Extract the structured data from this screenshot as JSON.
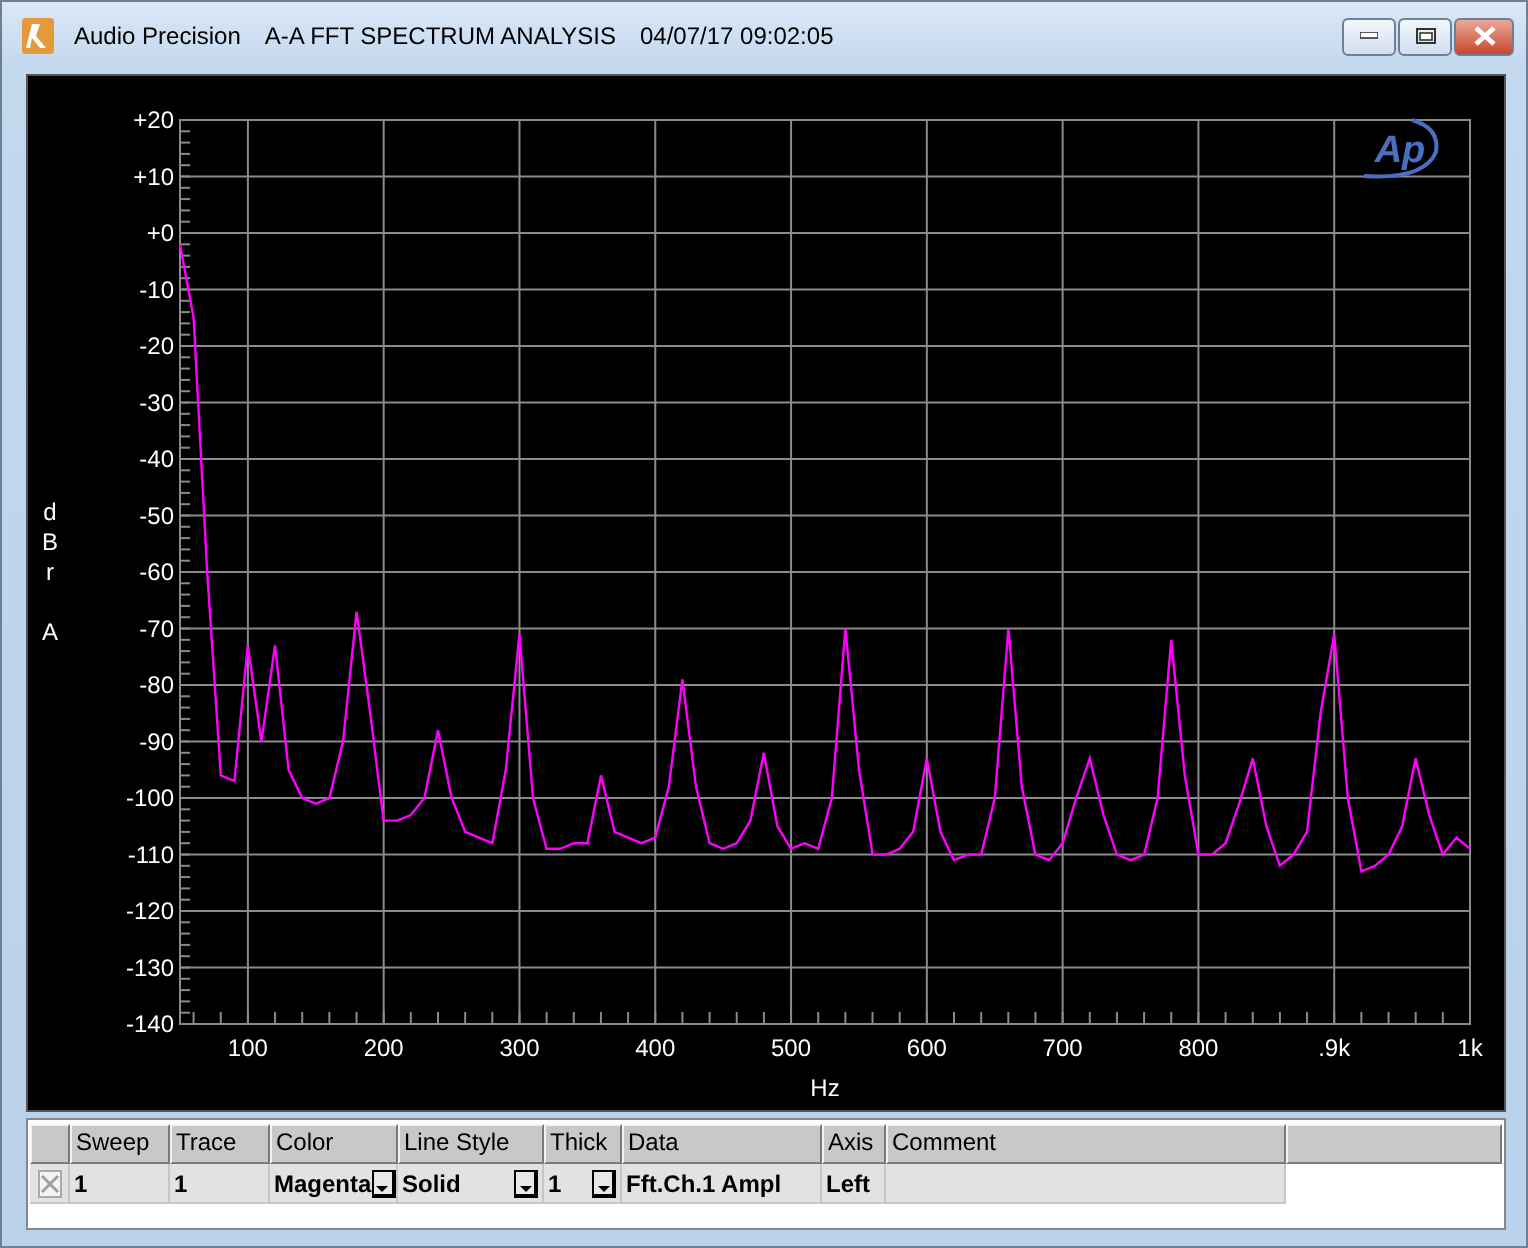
{
  "window": {
    "app": "Audio Precision",
    "title": "A-A FFT SPECTRUM ANALYSIS",
    "timestamp": "04/07/17 09:02:05"
  },
  "chart": {
    "logo": "Ap",
    "chart_data": {
      "type": "line",
      "xlabel": "Hz",
      "ylabel": "dBr A",
      "x": [
        50,
        60,
        70,
        80,
        90,
        100,
        110,
        120,
        130,
        140,
        150,
        160,
        170,
        180,
        190,
        200,
        210,
        220,
        230,
        240,
        250,
        260,
        270,
        280,
        290,
        300,
        310,
        320,
        330,
        340,
        350,
        360,
        370,
        380,
        390,
        400,
        410,
        420,
        430,
        440,
        450,
        460,
        470,
        480,
        490,
        500,
        510,
        520,
        530,
        540,
        550,
        560,
        570,
        580,
        590,
        600,
        610,
        620,
        630,
        640,
        650,
        660,
        670,
        680,
        690,
        700,
        710,
        720,
        730,
        740,
        750,
        760,
        770,
        780,
        790,
        800,
        810,
        820,
        830,
        840,
        850,
        860,
        870,
        880,
        890,
        900,
        910,
        920,
        930,
        940,
        950,
        960,
        970,
        980,
        990,
        1000
      ],
      "grid": true,
      "series": [
        {
          "color": "#ff00ff",
          "values": [
            -2,
            -15,
            -60,
            -96,
            -97,
            -73,
            -90,
            -73,
            -95,
            -100,
            -101,
            -100,
            -90,
            -67,
            -85,
            -104,
            -104,
            -103,
            -100,
            -88,
            -100,
            -106,
            -107,
            -108,
            -95,
            -71,
            -100,
            -109,
            -109,
            -108,
            -108,
            -96,
            -106,
            -107,
            -108,
            -107,
            -98,
            -79,
            -98,
            -108,
            -109,
            -108,
            -104,
            -92,
            -105,
            -109,
            -108,
            -109,
            -100,
            -70,
            -95,
            -110,
            -110,
            -109,
            -106,
            -93,
            -106,
            -111,
            -110,
            -110,
            -100,
            -70,
            -98,
            -110,
            -111,
            -108,
            -100,
            -93,
            -103,
            -110,
            -111,
            -110,
            -100,
            -72,
            -96,
            -110,
            -110,
            -108,
            -101,
            -93,
            -105,
            -112,
            -110,
            -106,
            -85,
            -71,
            -100,
            -113,
            -112,
            -110,
            -105,
            -93,
            -103,
            -110,
            -107,
            -109
          ]
        }
      ],
      "xlim": [
        50,
        1000
      ],
      "ylim": [
        -140,
        20
      ],
      "xticks": [
        100,
        200,
        300,
        400,
        500,
        600,
        700,
        800,
        {
          "value": 900,
          "label": ".9k"
        },
        {
          "value": 1000,
          "label": "1k"
        }
      ],
      "yticks": [
        {
          "value": 20,
          "label": "+20"
        },
        {
          "value": 10,
          "label": "+10"
        },
        {
          "value": 0,
          "label": "+0"
        },
        -10,
        -20,
        -30,
        -40,
        -50,
        -60,
        -70,
        -80,
        -90,
        -100,
        -110,
        -120,
        -130,
        -140
      ]
    }
  },
  "trace_table": {
    "columns": [
      "Sweep",
      "Trace",
      "Color",
      "Line Style",
      "Thick",
      "Data",
      "Axis",
      "Comment"
    ],
    "rows": [
      {
        "checked": true,
        "cells": [
          {
            "kind": "text",
            "text": "1"
          },
          {
            "kind": "text",
            "text": "1"
          },
          {
            "kind": "dropdown",
            "text": "Magenta"
          },
          {
            "kind": "dropdown",
            "text": "Solid"
          },
          {
            "kind": "dropdown",
            "text": "1"
          },
          {
            "kind": "text",
            "text": "Fft.Ch.1 Ampl"
          },
          {
            "kind": "text",
            "text": "Left"
          },
          {
            "kind": "text"
          }
        ]
      }
    ]
  }
}
